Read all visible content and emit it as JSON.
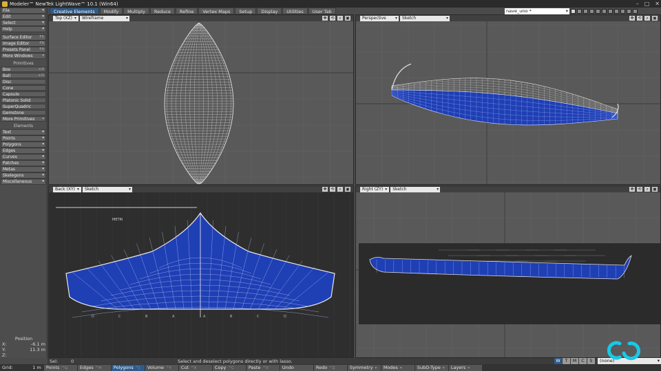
{
  "window": {
    "title": "Modeler™ NewTek LightWave™ 10.1 (Win64)"
  },
  "tabs": [
    "Creative Elements",
    "Modify",
    "Multiply",
    "Reduce",
    "Refine",
    "Vertex Maps",
    "Setup",
    "Display",
    "Utilities",
    "User Tab"
  ],
  "layer": {
    "name": "nave_uno *"
  },
  "left_menu": [
    {
      "label": "File",
      "arrow": "▾"
    },
    {
      "label": "Edit",
      "arrow": "▾"
    },
    {
      "label": "Select",
      "arrow": "▾"
    },
    {
      "label": "Help",
      "arrow": "▾"
    }
  ],
  "left_tools": [
    {
      "label": "Surface Editor",
      "shortcut": "F5"
    },
    {
      "label": "Image Editor",
      "shortcut": "F6"
    },
    {
      "label": "Presets Panel",
      "shortcut": "F8"
    },
    {
      "label": "More Windows",
      "shortcut": "▾"
    }
  ],
  "primitives": {
    "heading": "Primitives",
    "items": [
      {
        "label": "Box",
        "shortcut": "+X"
      },
      {
        "label": "Ball",
        "shortcut": "+O"
      },
      {
        "label": "Disc",
        "shortcut": ""
      },
      {
        "label": "Cone",
        "shortcut": ""
      },
      {
        "label": "Capsule",
        "shortcut": ""
      },
      {
        "label": "Platonic Solid",
        "shortcut": ""
      },
      {
        "label": "SuperQuadric",
        "shortcut": ""
      },
      {
        "label": "Gemstone",
        "shortcut": ""
      },
      {
        "label": "More Primitives",
        "shortcut": "▾"
      }
    ]
  },
  "elements": {
    "heading": "Elements",
    "items": [
      {
        "label": "Text",
        "arrow": "▾"
      },
      {
        "label": "Points",
        "arrow": "▾"
      },
      {
        "label": "Polygons",
        "arrow": "▾"
      },
      {
        "label": "Edges",
        "arrow": "▾"
      },
      {
        "label": "Curves",
        "arrow": "▾"
      },
      {
        "label": "Patches",
        "arrow": "▾"
      },
      {
        "label": "Metas",
        "arrow": "▾"
      },
      {
        "label": "Skelegons",
        "arrow": "▾"
      },
      {
        "label": "Miscellaneous",
        "arrow": "▾"
      }
    ]
  },
  "position": {
    "title": "Position",
    "x_label": "X:",
    "x": "-6.1 m",
    "y_label": "Y:",
    "y": "11.3 m",
    "z_label": "Z:",
    "z": ""
  },
  "viewports": {
    "top": {
      "view": "Top",
      "axis": "(XZ)",
      "mode": "Wireframe"
    },
    "perspective": {
      "view": "Perspective",
      "mode": "Sketch"
    },
    "back": {
      "view": "Back",
      "axis": "(XY)",
      "mode": "Sketch",
      "ruler_label": "METRI",
      "station_letters": [
        "D",
        "C",
        "B",
        "A",
        "A",
        "B",
        "C",
        "D"
      ]
    },
    "right": {
      "view": "Right",
      "axis": "(ZY)",
      "mode": "Sketch"
    }
  },
  "status": {
    "sel_label": "Sel:",
    "sel_value": "0",
    "message": "Select and deselect polygons directly or with lasso."
  },
  "view_buttons": [
    "W",
    "T",
    "M",
    "C",
    "S"
  ],
  "surface_select": "(none)",
  "bottom": {
    "grid_label": "Grid:",
    "grid_value": "1 m",
    "buttons": [
      {
        "label": "Points",
        "sc": "^G",
        "active": false
      },
      {
        "label": "Edges",
        "sc": "^H",
        "active": false
      },
      {
        "label": "Polygons",
        "sc": "^J",
        "active": true
      },
      {
        "label": "Volume",
        "sc": "^Y",
        "active": false
      },
      {
        "label": "Cut",
        "sc": "^X",
        "active": false
      },
      {
        "label": "Copy",
        "sc": "^C",
        "active": false
      },
      {
        "label": "Paste",
        "sc": "^V",
        "active": false
      },
      {
        "label": "Undo",
        "sc": "",
        "active": false
      },
      {
        "label": "Redo",
        "sc": "^Z",
        "active": false
      },
      {
        "label": "Symmetry",
        "sc": "▾",
        "active": false
      },
      {
        "label": "Modes",
        "sc": "▾",
        "active": false
      },
      {
        "label": "SubD-Type",
        "sc": "▾",
        "active": false
      },
      {
        "label": "Layers",
        "sc": "▾",
        "active": false
      }
    ]
  },
  "colors": {
    "hull_blue": "#1f3fb4",
    "tab_active": "#2f5b8a",
    "logo_cyan": "#19c8e6",
    "wire": "#e6e6e6"
  }
}
